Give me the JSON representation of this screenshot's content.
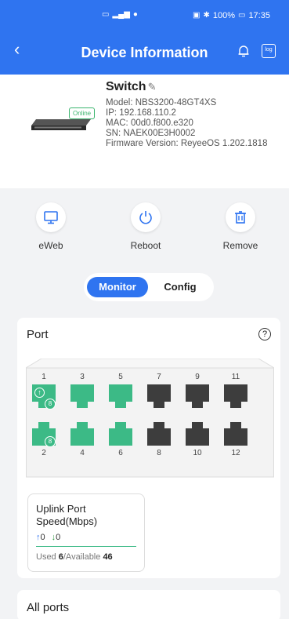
{
  "status_bar": {
    "battery": "100%",
    "time": "17:35",
    "signal_icon": "signal-icon",
    "wifi_icon": "hd-icon"
  },
  "header": {
    "title": "Device Information",
    "back_icon": "back-icon",
    "bell_icon": "bell-icon",
    "log_label": "log"
  },
  "device": {
    "name": "Switch",
    "status": "Online",
    "model": "Model: NBS3200-48GT4XS",
    "ip": "IP:  192.168.110.2",
    "mac": "MAC:  00d0.f800.e320",
    "sn": "SN: NAEK00E3H0002",
    "firmware": "Firmware Version: ReyeeOS 1.202.1818"
  },
  "actions": [
    {
      "label": "eWeb",
      "icon": "monitor-icon"
    },
    {
      "label": "Reboot",
      "icon": "power-icon"
    },
    {
      "label": "Remove",
      "icon": "trash-icon"
    }
  ],
  "tabs": {
    "monitor": "Monitor",
    "config": "Config",
    "active": "Monitor"
  },
  "port_section": {
    "title": "Port",
    "help_icon": "?",
    "ports": [
      {
        "num": "1",
        "status": "up",
        "uplink": true,
        "badge": "8"
      },
      {
        "num": "2",
        "status": "up",
        "uplink": false,
        "badge": "8"
      },
      {
        "num": "3",
        "status": "up"
      },
      {
        "num": "4",
        "status": "up"
      },
      {
        "num": "5",
        "status": "up"
      },
      {
        "num": "6",
        "status": "up"
      },
      {
        "num": "7",
        "status": "down"
      },
      {
        "num": "8",
        "status": "down"
      },
      {
        "num": "9",
        "status": "down"
      },
      {
        "num": "10",
        "status": "down"
      },
      {
        "num": "11",
        "status": "down"
      },
      {
        "num": "12",
        "status": "down"
      }
    ],
    "colors": {
      "up": "#3cba86",
      "down": "#3d3d3d"
    }
  },
  "uplink": {
    "title": "Uplink Port Speed(Mbps)",
    "up_arrow": "↑",
    "up": "0",
    "down_arrow": "↓",
    "down": "0",
    "used_label": "Used ",
    "used": "6",
    "available_label": "/Available ",
    "available": "46"
  },
  "all_ports": {
    "title": "All ports"
  }
}
